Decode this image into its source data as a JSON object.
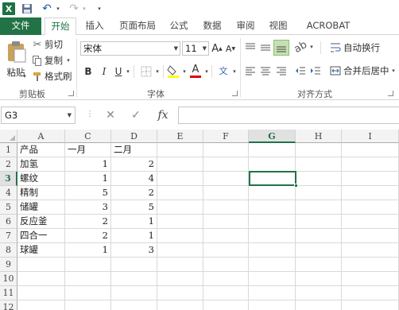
{
  "app": {
    "logo_letter": "X"
  },
  "tabs": [
    "文件",
    "开始",
    "插入",
    "页面布局",
    "公式",
    "数据",
    "审阅",
    "视图",
    "ACROBAT"
  ],
  "ribbon": {
    "clipboard": {
      "paste": "粘贴",
      "cut": "剪切",
      "copy": "复制",
      "format_painter": "格式刷",
      "label": "剪贴板"
    },
    "font": {
      "name": "宋体",
      "size": "11",
      "grow": "A",
      "shrink": "A",
      "bold": "B",
      "italic": "I",
      "underline": "U",
      "font_color_letter": "A",
      "phonetic": "文",
      "label": "字体"
    },
    "alignment": {
      "wrap_text": "自动换行",
      "merge_center": "合并后居中",
      "label": "对齐方式"
    }
  },
  "formula_bar": {
    "name_box": "G3",
    "cancel": "✕",
    "enter": "✓",
    "fx": "fx",
    "content": ""
  },
  "sheet": {
    "columns": [
      "A",
      "C",
      "D",
      "E",
      "F",
      "G",
      "H",
      "I"
    ],
    "selected_column": "G",
    "selected_row": 3,
    "row_numbers": [
      "1",
      "2",
      "3",
      "4",
      "5",
      "6",
      "7",
      "8",
      "9",
      "10",
      "11",
      "12"
    ],
    "header_row": [
      "产品",
      "一月",
      "二月"
    ],
    "rows": [
      [
        "加氢",
        "1",
        "2"
      ],
      [
        "螺纹",
        "1",
        "4"
      ],
      [
        "精制",
        "5",
        "2"
      ],
      [
        "储罐",
        "3",
        "5"
      ],
      [
        "反应釜",
        "2",
        "1"
      ],
      [
        "四合一",
        "2",
        "1"
      ],
      [
        "球罐",
        "1",
        "3"
      ]
    ]
  },
  "colors": {
    "excel_green": "#217346",
    "header_bg": "#f3f3f3",
    "grid_line": "#d9d9d9"
  }
}
